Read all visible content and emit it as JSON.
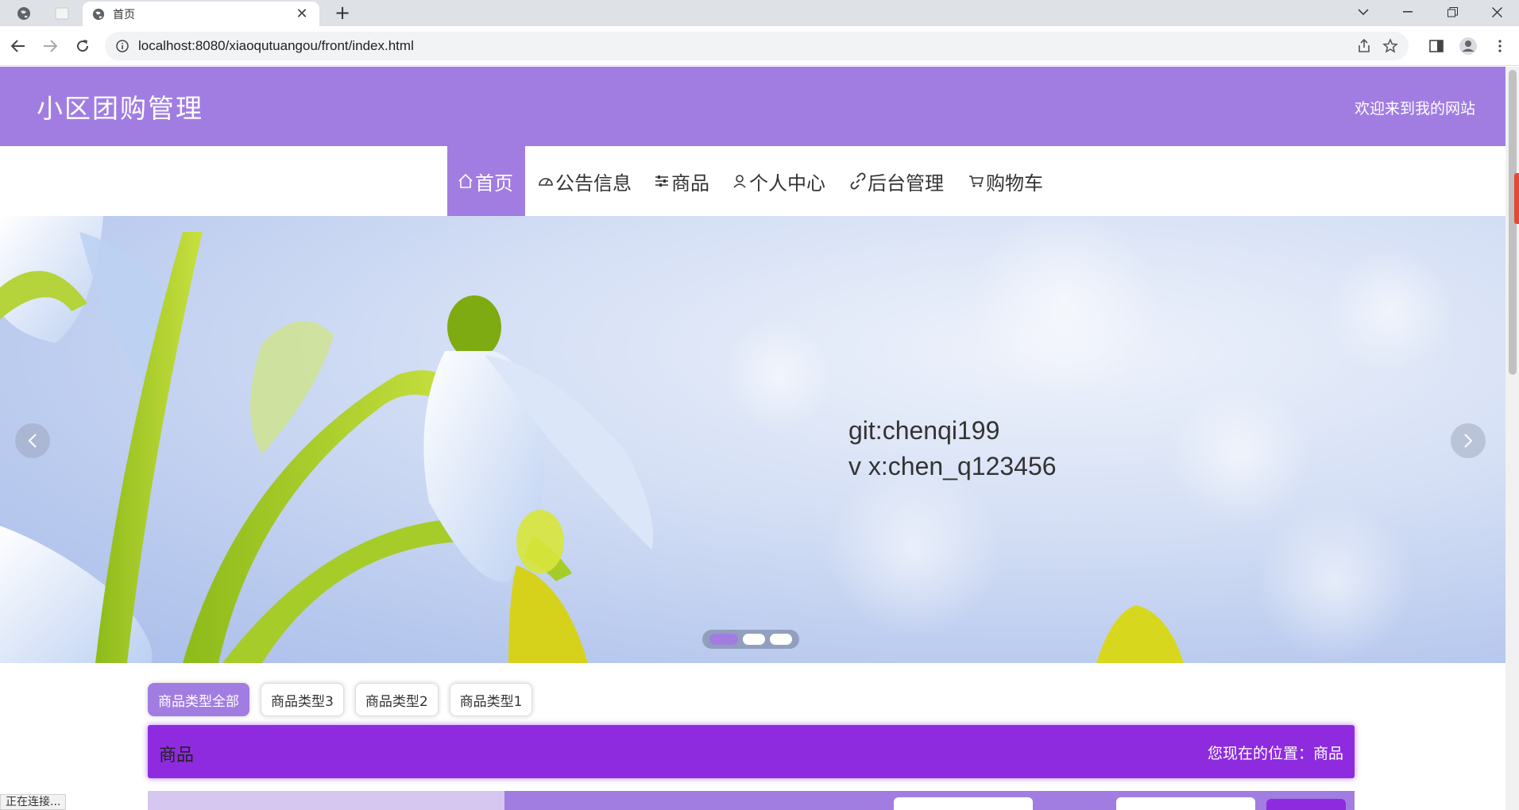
{
  "browser": {
    "tab_title": "首页",
    "url": "localhost:8080/xiaoqutuangou/front/index.html",
    "status_text": "正在连接..."
  },
  "header": {
    "site_title": "小区团购管理",
    "welcome": "欢迎来到我的网站"
  },
  "nav": {
    "items": [
      {
        "label": "首页",
        "icon": "home-icon",
        "active": true
      },
      {
        "label": "公告信息",
        "icon": "gauge-icon"
      },
      {
        "label": "商品",
        "icon": "sliders-icon"
      },
      {
        "label": "个人中心",
        "icon": "user-icon"
      },
      {
        "label": "后台管理",
        "icon": "link-icon"
      },
      {
        "label": "购物车",
        "icon": "cart-icon"
      }
    ]
  },
  "banner": {
    "line1": "git:chenqi199",
    "line2": "v x:chen_q123456",
    "slide_count": 3,
    "active_slide": 1
  },
  "filters": {
    "items": [
      "商品类型全部",
      "商品类型3",
      "商品类型2",
      "商品类型1"
    ],
    "active_index": 0
  },
  "section": {
    "title": "商品",
    "location": "您现在的位置：商品"
  },
  "colors": {
    "accent": "#a17de2",
    "section_bar": "#8e2bdf"
  }
}
